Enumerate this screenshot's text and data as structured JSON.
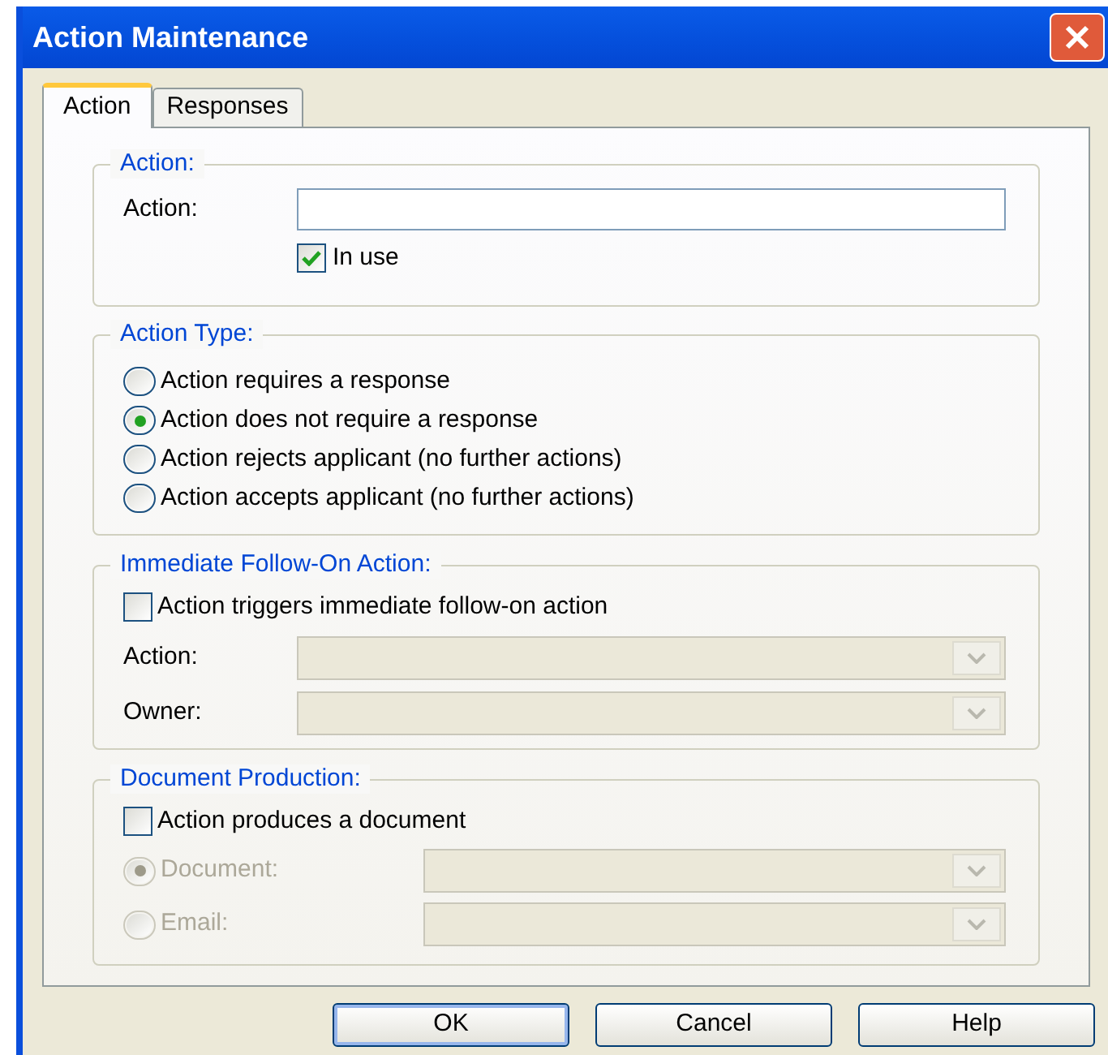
{
  "window": {
    "title": "Action Maintenance"
  },
  "tabs": [
    {
      "label": "Action",
      "selected": true
    },
    {
      "label": "Responses",
      "selected": false
    }
  ],
  "action_group": {
    "title": "Action:",
    "field_label": "Action:",
    "in_use": {
      "label": "In use",
      "checked": true
    }
  },
  "action_type": {
    "title": "Action Type:",
    "options": [
      {
        "label": "Action requires a response",
        "selected": false
      },
      {
        "label": "Action does not require a response",
        "selected": true
      },
      {
        "label": "Action rejects applicant (no further actions)",
        "selected": false
      },
      {
        "label": "Action accepts applicant (no further actions)",
        "selected": false
      }
    ]
  },
  "follow_on": {
    "title": "Immediate Follow-On Action:",
    "trigger": {
      "label": "Action triggers immediate follow-on action",
      "checked": false
    },
    "fields": [
      {
        "label": "Action:",
        "disabled": true
      },
      {
        "label": "Owner:",
        "disabled": true
      }
    ]
  },
  "document_production": {
    "title": "Document Production:",
    "produces": {
      "label": "Action produces a document",
      "checked": false
    },
    "options": [
      {
        "label": "Document:",
        "selected": true,
        "disabled": true
      },
      {
        "label": "Email:",
        "selected": false,
        "disabled": true
      }
    ]
  },
  "buttons": [
    {
      "label": "OK",
      "default": true
    },
    {
      "label": "Cancel",
      "default": false
    },
    {
      "label": "Help",
      "default": false
    }
  ]
}
